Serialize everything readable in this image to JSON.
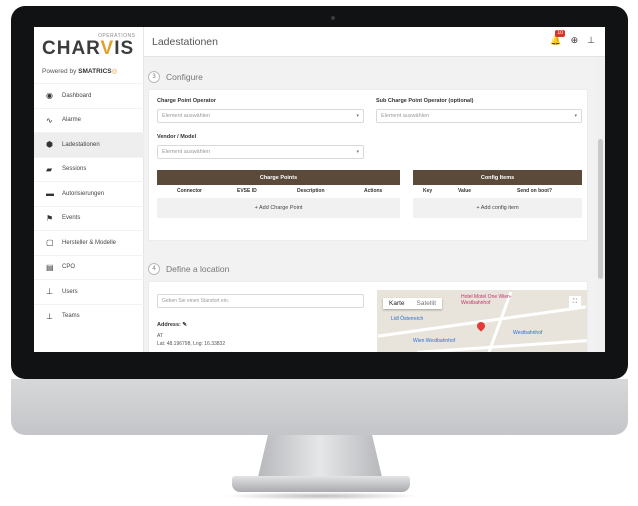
{
  "app": {
    "logo_top": "OPERATIONS",
    "logo_main": "CHARGIS",
    "logo_left": "CHAR",
    "logo_accent": "V",
    "logo_right": "IS",
    "powered_by": "Powered by",
    "powered_brand": "SMATRICS"
  },
  "sidebar": {
    "items": [
      {
        "label": "Dashboard",
        "icon": "dashboard-icon",
        "glyph": "◉"
      },
      {
        "label": "Alarme",
        "icon": "pulse-icon",
        "glyph": "∿"
      },
      {
        "label": "Ladestationen",
        "icon": "charging-station-icon",
        "glyph": "⬢"
      },
      {
        "label": "Sessions",
        "icon": "sessions-icon",
        "glyph": "▰"
      },
      {
        "label": "Autorisierungen",
        "icon": "card-icon",
        "glyph": "▬"
      },
      {
        "label": "Events",
        "icon": "flag-icon",
        "glyph": "⚑"
      },
      {
        "label": "Hersteller & Modelle",
        "icon": "manufacturer-icon",
        "glyph": "▢"
      },
      {
        "label": "CPO",
        "icon": "briefcase-icon",
        "glyph": "▤"
      },
      {
        "label": "Users",
        "icon": "user-icon",
        "glyph": "⊥"
      },
      {
        "label": "Teams",
        "icon": "team-icon",
        "glyph": "⊥"
      }
    ],
    "active_index": 2
  },
  "header": {
    "title": "Ladestationen",
    "notification_count": "10",
    "icons": [
      "bell-icon",
      "globe-icon",
      "user-icon"
    ]
  },
  "configure": {
    "step": "3",
    "title": "Configure",
    "cpo_label": "Charge Point Operator",
    "cpo_placeholder": "Element auswählen",
    "sub_cpo_label": "Sub Charge Point Operator (optional)",
    "sub_cpo_placeholder": "Element auswählen",
    "vendor_label": "Vendor / Model",
    "vendor_placeholder": "Element auswählen",
    "charge_points": {
      "title": "Charge Points",
      "columns": [
        "Connector",
        "EVSE ID",
        "Description",
        "Actions"
      ],
      "add_label": "+ Add Charge Point"
    },
    "config_items": {
      "title": "Config Items",
      "columns": [
        "Key",
        "Value",
        "Send on boot?"
      ],
      "add_label": "+ Add config item"
    }
  },
  "location": {
    "step": "4",
    "title": "Define a location",
    "search_placeholder": "Geben Sie einen Standort ein.",
    "address_label": "Address:",
    "address_line1": "AT",
    "address_line2": "Lat: 48.196798, Lng: 16.33832",
    "map": {
      "btn_map": "Karte",
      "btn_satellite": "Satellit",
      "labels": [
        "Hotel Motel One Wien-Westbahnhof",
        "Lidl Österreich",
        "Wien Westbahnhof",
        "Westbahnhof"
      ]
    }
  },
  "colors": {
    "accent": "#e0a12d",
    "table_header": "#5b4a3a",
    "badge": "#d9342b"
  }
}
